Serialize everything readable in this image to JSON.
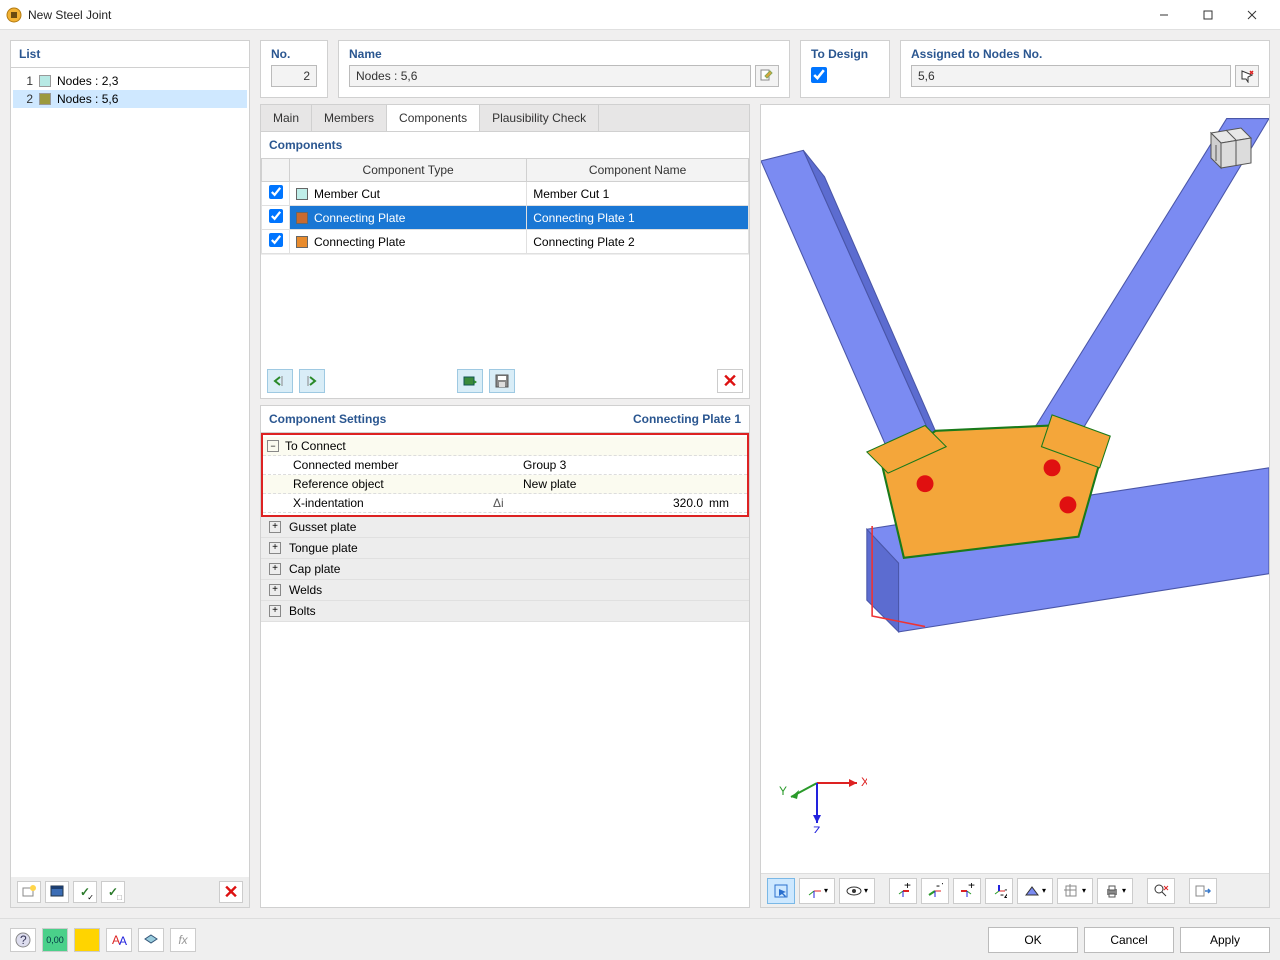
{
  "window": {
    "title": "New Steel Joint"
  },
  "list": {
    "title": "List",
    "items": [
      {
        "num": "1",
        "label": "Nodes : 2,3",
        "color": "#b7e9e4",
        "selected": false
      },
      {
        "num": "2",
        "label": "Nodes : 5,6",
        "color": "#9c9a3e",
        "selected": true
      }
    ]
  },
  "header": {
    "no_label": "No.",
    "no_value": "2",
    "name_label": "Name",
    "name_value": "Nodes : 5,6",
    "design_label": "To Design",
    "design_checked": true,
    "nodes_label": "Assigned to Nodes No.",
    "nodes_value": "5,6"
  },
  "tabs": {
    "items": [
      "Main",
      "Members",
      "Components",
      "Plausibility Check"
    ],
    "active": 2
  },
  "components": {
    "title": "Components",
    "columns": [
      "",
      "Component Type",
      "Component Name"
    ],
    "rows": [
      {
        "checked": true,
        "color": "#bfeee9",
        "type": "Member Cut",
        "name": "Member Cut 1",
        "selected": false
      },
      {
        "checked": true,
        "color": "#c96a2f",
        "type": "Connecting Plate",
        "name": "Connecting Plate 1",
        "selected": true
      },
      {
        "checked": true,
        "color": "#e88b2d",
        "type": "Connecting Plate",
        "name": "Connecting Plate 2",
        "selected": false
      }
    ]
  },
  "settings": {
    "title": "Component Settings",
    "subtitle": "Connecting Plate 1",
    "to_connect": {
      "label": "To Connect",
      "connected_member": {
        "label": "Connected member",
        "value": "Group 3"
      },
      "reference_object": {
        "label": "Reference object",
        "value": "New plate"
      },
      "x_indent": {
        "label": "X-indentation",
        "symbol": "Δi",
        "value": "320.0",
        "unit": "mm"
      }
    },
    "groups": [
      "Gusset plate",
      "Tongue plate",
      "Cap plate",
      "Welds",
      "Bolts"
    ]
  },
  "viewer": {
    "axis": {
      "x": "X",
      "y": "Y",
      "z": "Z"
    }
  },
  "footer": {
    "ok": "OK",
    "cancel": "Cancel",
    "apply": "Apply"
  }
}
